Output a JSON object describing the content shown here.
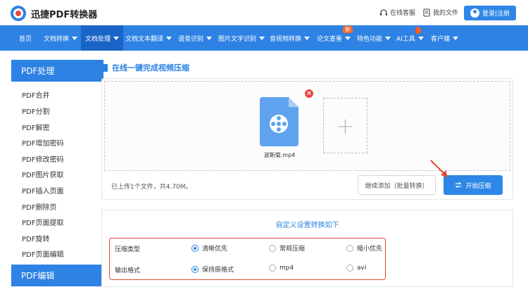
{
  "header": {
    "brand": "迅捷PDF转换器",
    "service_link": "在线客服",
    "files_link": "我的文件",
    "login": "登录|注册"
  },
  "nav": {
    "items": [
      {
        "label": "首页",
        "caret": false
      },
      {
        "label": "文档转换",
        "caret": true
      },
      {
        "label": "文档处理",
        "caret": true,
        "active": true
      },
      {
        "label": "文档文本翻译",
        "caret": true
      },
      {
        "label": "语音识别",
        "caret": true
      },
      {
        "label": "图片文字识别",
        "caret": true
      },
      {
        "label": "音视频转换",
        "caret": true
      },
      {
        "label": "论文查重",
        "caret": true
      },
      {
        "label": "特色功能",
        "caret": true
      },
      {
        "label": "AI工具",
        "caret": true
      },
      {
        "label": "客户端",
        "caret": true
      }
    ],
    "new_badge": "新"
  },
  "sidebar": {
    "pdf_process_head": "PDF处理",
    "items": [
      "PDF合并",
      "PDF分割",
      "PDF解密",
      "PDF增加密码",
      "PDF修改密码",
      "PDF图片获取",
      "PDF插入页面",
      "PDF删除页",
      "PDF页面提取",
      "PDF旋转",
      "PDF页面编辑"
    ],
    "pdf_edit_head": "PDF编辑"
  },
  "main": {
    "title": "在线一键完成视频压缩",
    "file_name": "波斯菊.mp4",
    "upload_status": "已上传1个文件，共4.70M。",
    "continue_btn": "继续添加（批量转换）",
    "start_btn": "开始压缩",
    "add_symbol": "+",
    "close_symbol": "×"
  },
  "settings": {
    "title": "自定义设置转换如下",
    "compress_label": "压缩类型",
    "compress_options": [
      "清晰优先",
      "常规压缩",
      "缩小优先"
    ],
    "compress_selected": "清晰优先",
    "format_label": "输出格式",
    "format_options": [
      "保持原格式",
      "mp4",
      "avi"
    ],
    "format_selected": "保持原格式"
  },
  "colors": {
    "primary": "#2d82e4",
    "nav_active": "#1a64c7",
    "highlight_frame": "#e24a33",
    "close_red": "#e84545"
  }
}
